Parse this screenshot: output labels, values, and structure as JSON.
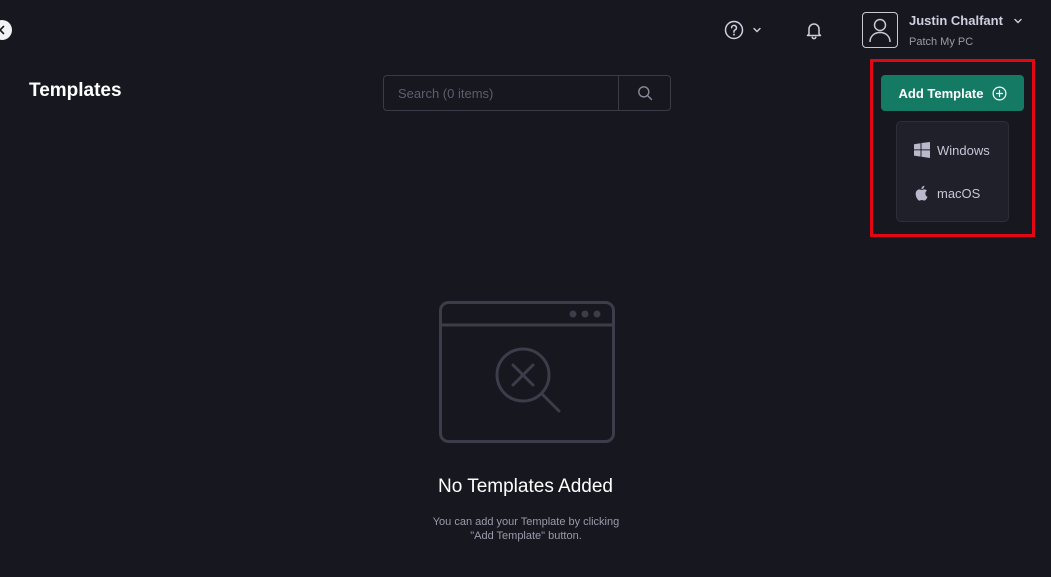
{
  "header": {
    "user_name": "Justin Chalfant",
    "user_org": "Patch My PC",
    "icons": [
      "back-icon",
      "help-icon",
      "chevron-down-icon",
      "bell-icon",
      "user-avatar-icon"
    ]
  },
  "main": {
    "title": "Templates",
    "search_placeholder": "Search (0 items)",
    "add_button_label": "Add Template",
    "dropdown": [
      {
        "label": "Windows",
        "icon": "windows-icon"
      },
      {
        "label": "macOS",
        "icon": "apple-icon"
      }
    ],
    "empty_state": {
      "title": "No Templates Added",
      "description": "You can add your Template by clicking \"Add Template\" button."
    }
  },
  "colors": {
    "background": "#17171f",
    "accent_button": "#157a64",
    "highlight_border": "#e30613",
    "dropdown_bg": "#20202a"
  }
}
